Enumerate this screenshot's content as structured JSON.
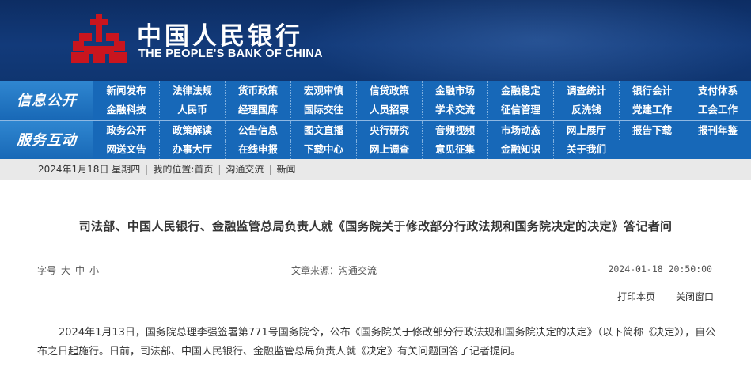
{
  "header": {
    "logo_cn": "中国人民银行",
    "logo_en": "THE PEOPLE'S BANK OF CHINA",
    "brand_color": "#c9151e"
  },
  "nav": {
    "row1_label": "信息公开",
    "row1_items": [
      [
        "新闻发布",
        "法律法规",
        "货币政策",
        "宏观审慎",
        "信贷政策",
        "金融市场",
        "金融稳定",
        "调查统计",
        "银行会计",
        "支付体系"
      ],
      [
        "金融科技",
        "人民币",
        "经理国库",
        "国际交往",
        "人员招录",
        "学术交流",
        "征信管理",
        "反洗钱",
        "党建工作",
        "工会工作"
      ]
    ],
    "row2_label": "服务互动",
    "row2_items": [
      [
        "政务公开",
        "政策解读",
        "公告信息",
        "图文直播",
        "央行研究",
        "音频视频",
        "市场动态",
        "网上展厅",
        "报告下载",
        "报刊年鉴"
      ],
      [
        "网送文告",
        "办事大厅",
        "在线申报",
        "下载中心",
        "网上调查",
        "意见征集",
        "金融知识",
        "关于我们"
      ]
    ]
  },
  "breadcrumb": {
    "date": "2024年1月18日 星期四",
    "location_label": "我的位置:",
    "home": "首页",
    "level1": "沟通交流",
    "level2": "新闻"
  },
  "article": {
    "title": "司法部、中国人民银行、金融监管总局负责人就《国务院关于修改部分行政法规和国务院决定的决定》答记者问",
    "font_size_label": "字号",
    "font_sizes": [
      "大",
      "中",
      "小"
    ],
    "source": "文章来源：沟通交流",
    "timestamp": "2024-01-18  20:50:00",
    "print_label": "打印本页",
    "close_label": "关闭窗口",
    "body": "2024年1月13日，国务院总理李强签署第771号国务院令，公布《国务院关于修改部分行政法规和国务院决定的决定》（以下简称《决定》），自公布之日起施行。日前，司法部、中国人民银行、金融监管总局负责人就《决定》有关问题回答了记者提问。"
  }
}
